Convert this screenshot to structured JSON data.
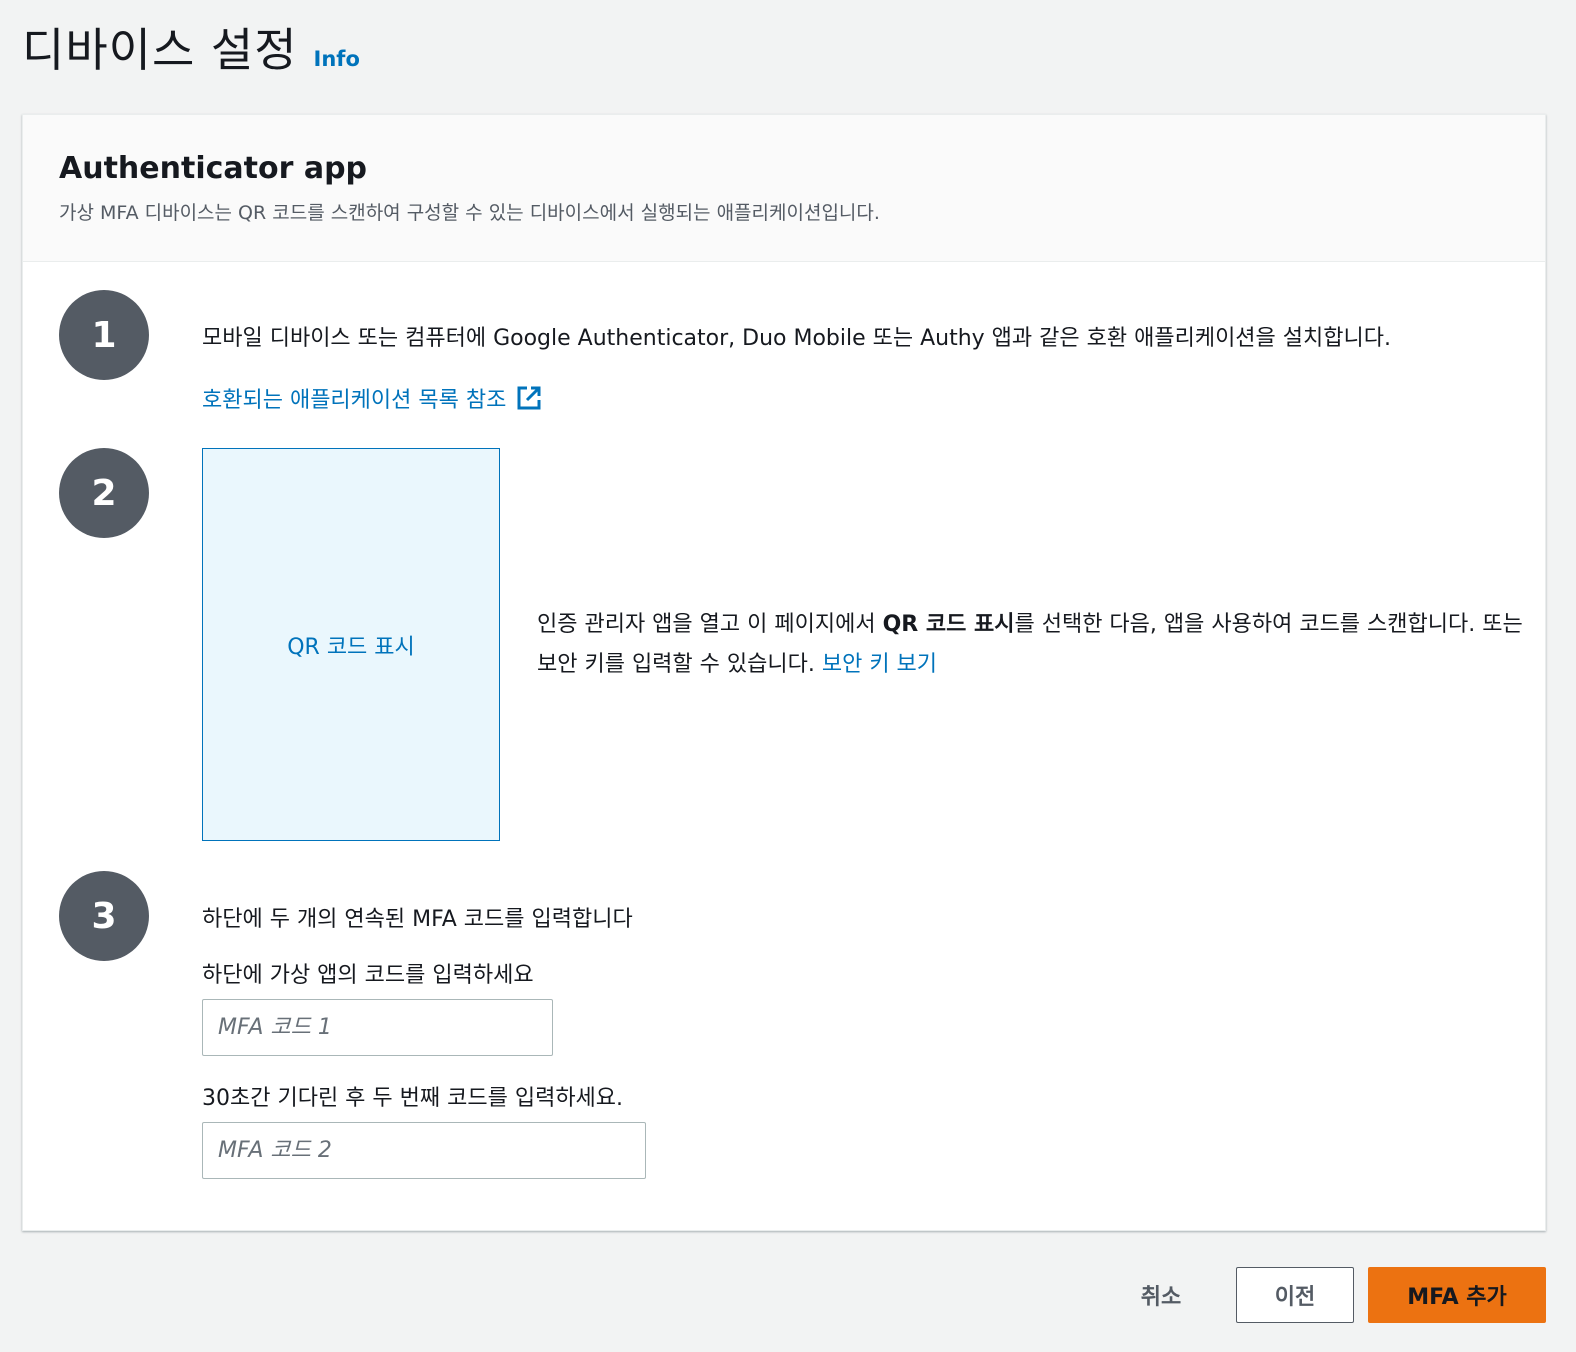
{
  "page": {
    "title": "디바이스 설정",
    "info_link": "Info"
  },
  "panel": {
    "title": "Authenticator app",
    "description": "가상 MFA 디바이스는 QR 코드를 스캔하여 구성할 수 있는 디바이스에서 실행되는 애플리케이션입니다."
  },
  "step1": {
    "number": "1",
    "text": "모바일 디바이스 또는 컴퓨터에 Google Authenticator, Duo Mobile 또는 Authy 앱과 같은 호환 애플리케이션을 설치합니다.",
    "link": "호환되는 애플리케이션 목록 참조",
    "link_icon": "external-link-icon"
  },
  "step2": {
    "number": "2",
    "qr_button": "QR 코드 표시",
    "desc_part1": "인증 관리자 앱을 열고 이 페이지에서 ",
    "desc_bold": "QR 코드 표시",
    "desc_part2": "를 선택한 다음, 앱을 사용하여 코드를 스캔합니다. 또는 보안 키를 입력할 수 있습니다. ",
    "desc_link": "보안 키 보기"
  },
  "step3": {
    "number": "3",
    "heading": "하단에 두 개의 연속된 MFA 코드를 입력합니다",
    "label1": "하단에 가상 앱의 코드를 입력하세요",
    "placeholder1": "MFA 코드 1",
    "value1": "",
    "label2": "30초간 기다린 후 두 번째 코드를 입력하세요.",
    "placeholder2": "MFA 코드 2",
    "value2": ""
  },
  "footer": {
    "cancel": "취소",
    "previous": "이전",
    "add_mfa": "MFA 추가"
  },
  "colors": {
    "link": "#0073bb",
    "primary_button": "#ec7211",
    "step_circle": "#545b64",
    "qr_box_bg": "#eaf7fd"
  }
}
